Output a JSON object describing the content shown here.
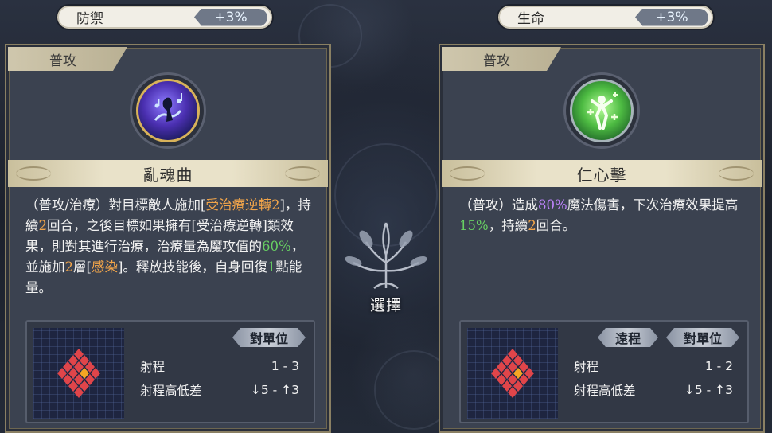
{
  "left": {
    "stat": {
      "name": "防禦",
      "value": "+3%"
    },
    "card": {
      "type_label": "普攻",
      "icon": "music-note-silhouette-icon",
      "skill_name": "亂魂曲",
      "desc_segments": [
        {
          "t": "（普攻/治療）對目標敵人施加[",
          "c": ""
        },
        {
          "t": "受治療逆轉",
          "c": "c-orange"
        },
        {
          "t": "2",
          "c": "c-orange"
        },
        {
          "t": "]，持續",
          "c": ""
        },
        {
          "t": "2",
          "c": "c-orange"
        },
        {
          "t": "回合，之後目標如果擁有[受治療逆轉]類效果，則對其進行治療，治療量為魔攻值的",
          "c": ""
        },
        {
          "t": "60%",
          "c": "c-green"
        },
        {
          "t": "，並施加",
          "c": ""
        },
        {
          "t": "2",
          "c": "c-orange"
        },
        {
          "t": "層[",
          "c": ""
        },
        {
          "t": "感染",
          "c": "c-orange"
        },
        {
          "t": "]。釋放技能後，自身回復",
          "c": ""
        },
        {
          "t": "1",
          "c": "c-green"
        },
        {
          "t": "點能量。",
          "c": ""
        }
      ],
      "tags": [
        "對單位"
      ],
      "range_label": "射程",
      "range_value": "1 - 3",
      "height_label": "射程高低差",
      "height_value": "↓5 - ↑3"
    }
  },
  "right": {
    "stat": {
      "name": "生命",
      "value": "+3%"
    },
    "card": {
      "type_label": "普攻",
      "icon": "healing-figure-icon",
      "skill_name": "仁心擊",
      "desc_segments": [
        {
          "t": "（普攻）造成",
          "c": ""
        },
        {
          "t": "80%",
          "c": "c-purple"
        },
        {
          "t": "魔法傷害，下次治療效果提高",
          "c": ""
        },
        {
          "t": "15%",
          "c": "c-green"
        },
        {
          "t": "，持續",
          "c": ""
        },
        {
          "t": "2",
          "c": "c-orange"
        },
        {
          "t": "回合。",
          "c": ""
        }
      ],
      "tags": [
        "遠程",
        "對單位"
      ],
      "range_label": "射程",
      "range_value": "1 - 2",
      "height_label": "射程高低差",
      "height_value": "↓5 - ↑3"
    }
  },
  "center": {
    "select_label": "選擇"
  },
  "colors": {
    "panel": "#3b4250",
    "gold_band": "#e9e2c9",
    "orange": "#f2a54a",
    "green": "#68d163",
    "purple": "#c084ff",
    "range_red": "#e0454a",
    "range_center": "#f5a623"
  }
}
